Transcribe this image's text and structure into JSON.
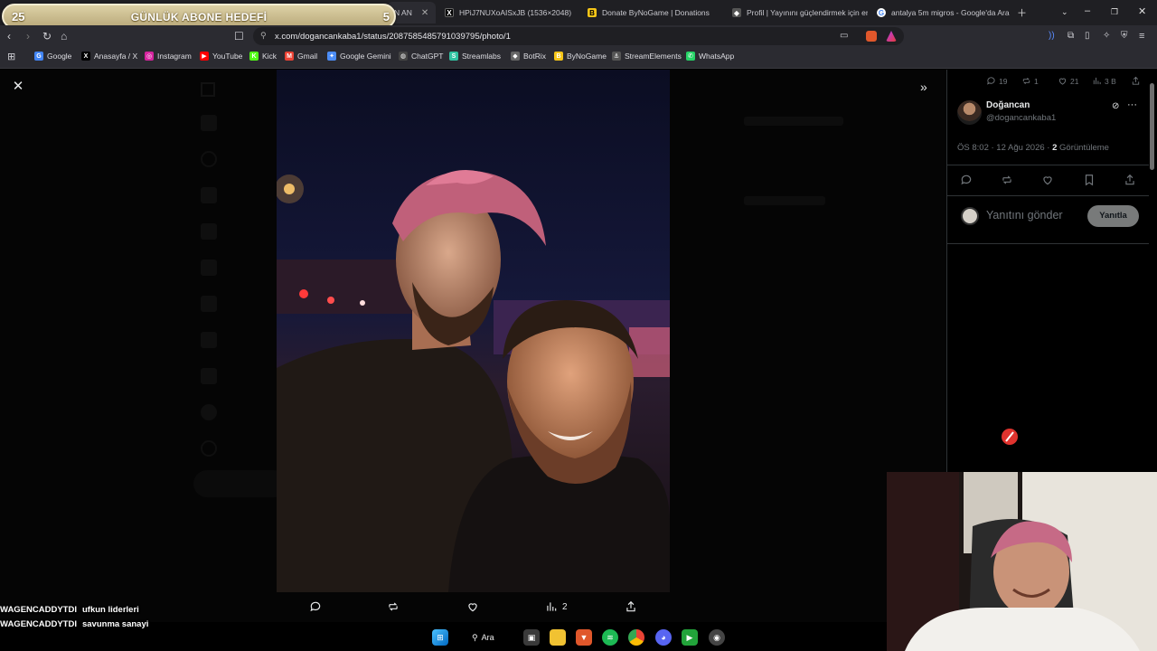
{
  "overlay": {
    "goal_current": "25",
    "goal_title": "GÜNLÜK ABONE HEDEFİ",
    "goal_target": "5"
  },
  "tabs": [
    {
      "label": "N AN",
      "active": true
    },
    {
      "label": "HPiJ7NUXoAISxJB (1536×2048)",
      "icon": "x-icon"
    },
    {
      "label": "Donate ByNoGame | Donations",
      "icon": "bynogame-icon"
    },
    {
      "label": "Profil | Yayınını güçlendirmek için en",
      "icon": "profile-icon"
    },
    {
      "label": "antalya 5m migros - Google'da Ara",
      "icon": "google-icon"
    }
  ],
  "url": "x.com/dogancankaba1/status/2087585485791039795/photo/1",
  "bookmarks": [
    {
      "label": "Google",
      "icon": "G",
      "color": "#4285f4"
    },
    {
      "label": "Anasayfa / X",
      "icon": "X",
      "color": "#000000"
    },
    {
      "label": "Instagram",
      "icon": "◎",
      "color": "#d6249f"
    },
    {
      "label": "YouTube",
      "icon": "▶",
      "color": "#ff0000"
    },
    {
      "label": "Kick",
      "icon": "K",
      "color": "#53fc18"
    },
    {
      "label": "Gmail",
      "icon": "M",
      "color": "#ea4335"
    },
    {
      "label": "Google Gemini",
      "icon": "✦",
      "color": "#4c8df6"
    },
    {
      "label": "ChatGPT",
      "icon": "◍",
      "color": "#444444"
    },
    {
      "label": "Streamlabs",
      "icon": "S",
      "color": "#31c3a2"
    },
    {
      "label": "BotRix",
      "icon": "◆",
      "color": "#666666"
    },
    {
      "label": "ByNoGame",
      "icon": "B",
      "color": "#f5c518"
    },
    {
      "label": "StreamElements",
      "icon": "⚓",
      "color": "#555555"
    },
    {
      "label": "WhatsApp",
      "icon": "✆",
      "color": "#25d366"
    }
  ],
  "tweet": {
    "reply_count": "19",
    "repost_count": "1",
    "like_count": "21",
    "view_count": "3 B",
    "author_name": "Doğancan",
    "author_handle": "@dogancankaba1",
    "time": "ÖS 8:02 · 12 Ağu 2026 · ",
    "views_number": "2",
    "views_label": " Görüntüleme",
    "reply_placeholder": "Yanıtını gönder",
    "reply_button": "Yanıtla"
  },
  "media_actions": {
    "views": "2"
  },
  "chat": [
    {
      "user": "WAGENCADDYTDI",
      "message": "ufkun liderleri"
    },
    {
      "user": "WAGENCADDYTDI",
      "message": "savunma sanayi"
    }
  ],
  "taskbar": {
    "search_label": "Ara"
  },
  "colors": {
    "x_background": "#000000",
    "goal_gold": "#c9b98a",
    "browser_chrome": "#2b2b31"
  }
}
